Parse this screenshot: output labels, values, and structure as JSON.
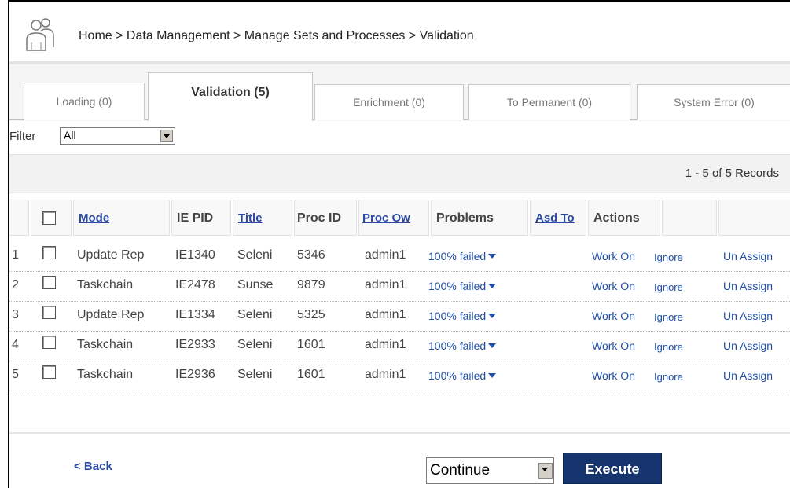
{
  "breadcrumb": "Home > Data Management > Manage Sets and Processes > Validation",
  "tabs": [
    {
      "label": "Loading (0)"
    },
    {
      "label": "Validation (5)"
    },
    {
      "label": "Enrichment (0)"
    },
    {
      "label": "To Permanent (0)"
    },
    {
      "label": "System Error (0)"
    }
  ],
  "filter": {
    "label": "Filter",
    "value": "All"
  },
  "records": "1 - 5 of 5 Records",
  "columns": {
    "mode": "Mode",
    "ie_pid": "IE PID",
    "title": "Title",
    "proc_id": "Proc ID",
    "proc_owner": "Proc Ow",
    "problems": "Problems",
    "asd_to": "Asd To",
    "actions": "Actions"
  },
  "rows": [
    {
      "num": "1",
      "mode": "Update Rep",
      "ie_pid": "IE1340",
      "title": "Seleni",
      "proc_id": "5346",
      "owner": "admin1",
      "problems": "100% failed",
      "work_on": "Work On",
      "ignore": "Ignore",
      "unassign": "Un Assign"
    },
    {
      "num": "2",
      "mode": "Taskchain",
      "ie_pid": "IE2478",
      "title": "Sunse",
      "proc_id": "9879",
      "owner": "admin1",
      "problems": "100% failed",
      "work_on": "Work On",
      "ignore": "Ignore",
      "unassign": "Un Assign"
    },
    {
      "num": "3",
      "mode": "Update Rep",
      "ie_pid": "IE1334",
      "title": "Seleni",
      "proc_id": "5325",
      "owner": "admin1",
      "problems": "100% failed",
      "work_on": "Work On",
      "ignore": "Ignore",
      "unassign": "Un Assign"
    },
    {
      "num": "4",
      "mode": "Taskchain",
      "ie_pid": "IE2933",
      "title": "Seleni",
      "proc_id": "1601",
      "owner": "admin1",
      "problems": "100% failed",
      "work_on": "Work On",
      "ignore": "Ignore",
      "unassign": "Un Assign"
    },
    {
      "num": "5",
      "mode": "Taskchain",
      "ie_pid": "IE2936",
      "title": "Seleni",
      "proc_id": "1601",
      "owner": "admin1",
      "problems": "100% failed",
      "work_on": "Work On",
      "ignore": "Ignore",
      "unassign": "Un Assign"
    }
  ],
  "footer": {
    "back": "< Back",
    "action_select": "Continue",
    "execute": "Execute"
  },
  "colors": {
    "link": "#1f4fa8",
    "execute_bg": "#16356e"
  }
}
